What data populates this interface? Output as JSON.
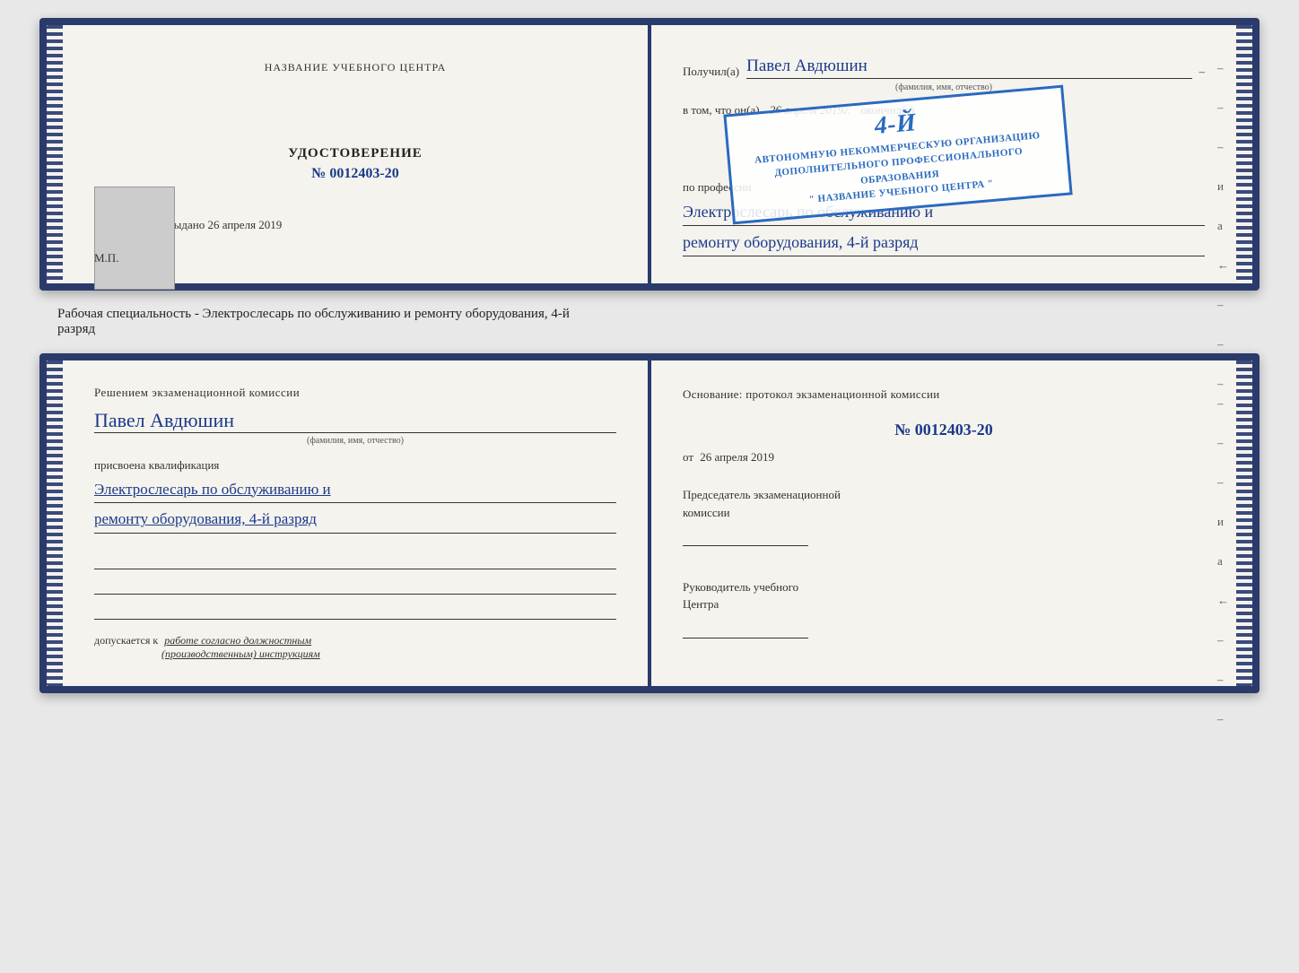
{
  "top_left": {
    "header": "НАЗВАНИЕ УЧЕБНОГО ЦЕНТРА",
    "cert_label": "УДОСТОВЕРЕНИЕ",
    "cert_number": "№ 0012403-20",
    "issued_label": "Выдано",
    "issued_date": "26 апреля 2019",
    "mp_label": "М.П."
  },
  "top_right": {
    "received_label": "Получил(а)",
    "recipient_name": "Павел Авдюшин",
    "fio_label": "(фамилия, имя, отчество)",
    "vtom_label": "в том, что он(а)",
    "vtom_date": "26 апреля 2019г.",
    "finished_label": "окончил(а)",
    "stamp_line1": "АВТОНОМНУЮ НЕКОММЕРЧЕСКУЮ ОРГАНИЗАЦИЮ",
    "stamp_line2": "ДОПОЛНИТЕЛЬНОГО ПРОФЕССИОНАЛЬНОГО ОБРАЗОВАНИЯ",
    "stamp_line3": "\" НАЗВАНИЕ УЧЕБНОГО ЦЕНТРА \"",
    "stamp_rank": "4-й",
    "profession_label": "по профессии",
    "profession_line1": "Электрослесарь по обслуживанию и",
    "profession_line2": "ремонту оборудования, 4-й разряд"
  },
  "specialty_line": "Рабочая специальность - Электрослесарь по обслуживанию и ремонту оборудования, 4-й",
  "specialty_line2": "разряд",
  "bottom_left": {
    "decision_text": "Решением экзаменационной комиссии",
    "person_name": "Павел Авдюшин",
    "fio_label": "(фамилия, имя, отчество)",
    "assigned_label": "присвоена квалификация",
    "qualification_line1": "Электрослесарь по обслуживанию и",
    "qualification_line2": "ремонту оборудования, 4-й разряд",
    "допускается_prefix": "допускается к",
    "допускается_text": "работе согласно должностным",
    "допускается_text2": "(производственным) инструкциям"
  },
  "bottom_right": {
    "basis_text": "Основание: протокол экзаменационной комиссии",
    "protocol_number": "№ 0012403-20",
    "from_label": "от",
    "from_date": "26 апреля 2019",
    "chairman_label": "Председатель экзаменационной",
    "chairman_label2": "комиссии",
    "center_head_label": "Руководитель учебного",
    "center_head_label2": "Центра"
  },
  "dashes_right_top": [
    "–",
    "–",
    "–",
    "и",
    "а",
    "←",
    "–",
    "–",
    "–"
  ],
  "dashes_right_bottom": [
    "–",
    "–",
    "–",
    "и",
    "а",
    "←",
    "–",
    "–",
    "–"
  ]
}
